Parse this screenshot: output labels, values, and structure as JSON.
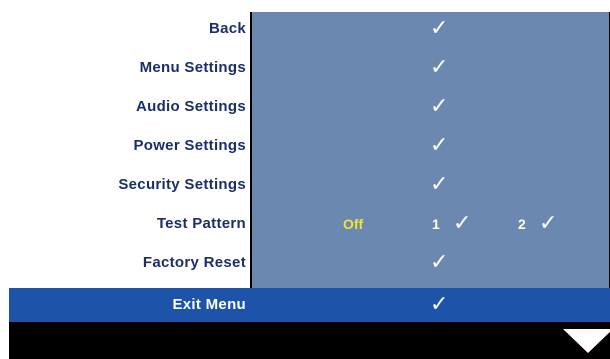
{
  "menu": {
    "items": [
      {
        "label": "Back",
        "check": "✓"
      },
      {
        "label": "Menu Settings",
        "check": "✓"
      },
      {
        "label": "Audio Settings",
        "check": "✓"
      },
      {
        "label": "Power Settings",
        "check": "✓"
      },
      {
        "label": "Security Settings",
        "check": "✓"
      },
      {
        "label": "Test Pattern",
        "off": "Off",
        "opt1": "1",
        "check1": "✓",
        "opt2": "2",
        "check2": "✓"
      },
      {
        "label": "Factory Reset",
        "check": "✓"
      }
    ],
    "exit": {
      "label": "Exit Menu",
      "check": "✓"
    }
  },
  "colors": {
    "value_bg": "#6b88b0",
    "label_text": "#1a2f6a",
    "selected_bg": "#1d53a8",
    "off_text": "#f2e23c"
  },
  "icons": [
    "checkmark-icon",
    "scroll-down-arrow-icon"
  ]
}
